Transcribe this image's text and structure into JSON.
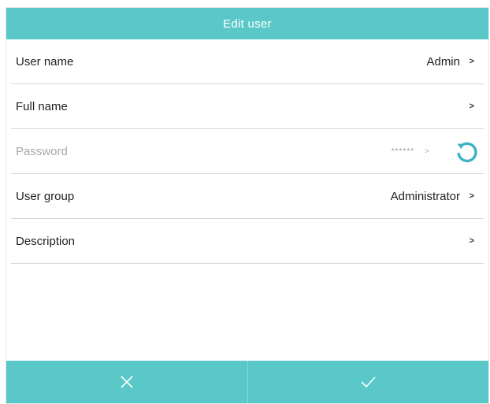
{
  "dialog": {
    "title": "Edit user"
  },
  "fields": {
    "user_name": {
      "label": "User name",
      "value": "Admin",
      "chevron": ">"
    },
    "full_name": {
      "label": "Full name",
      "value": "",
      "chevron": ">"
    },
    "password": {
      "label": "Password",
      "value": "******",
      "chevron": ">"
    },
    "user_group": {
      "label": "User group",
      "value": "Administrator",
      "chevron": ">"
    },
    "description": {
      "label": "Description",
      "value": "",
      "chevron": ">"
    }
  },
  "icons": {
    "reset": "reset-icon",
    "cancel": "close-icon",
    "confirm": "check-icon"
  },
  "colors": {
    "accent": "#5ac8c8",
    "reset_icon": "#3fb2c6"
  }
}
